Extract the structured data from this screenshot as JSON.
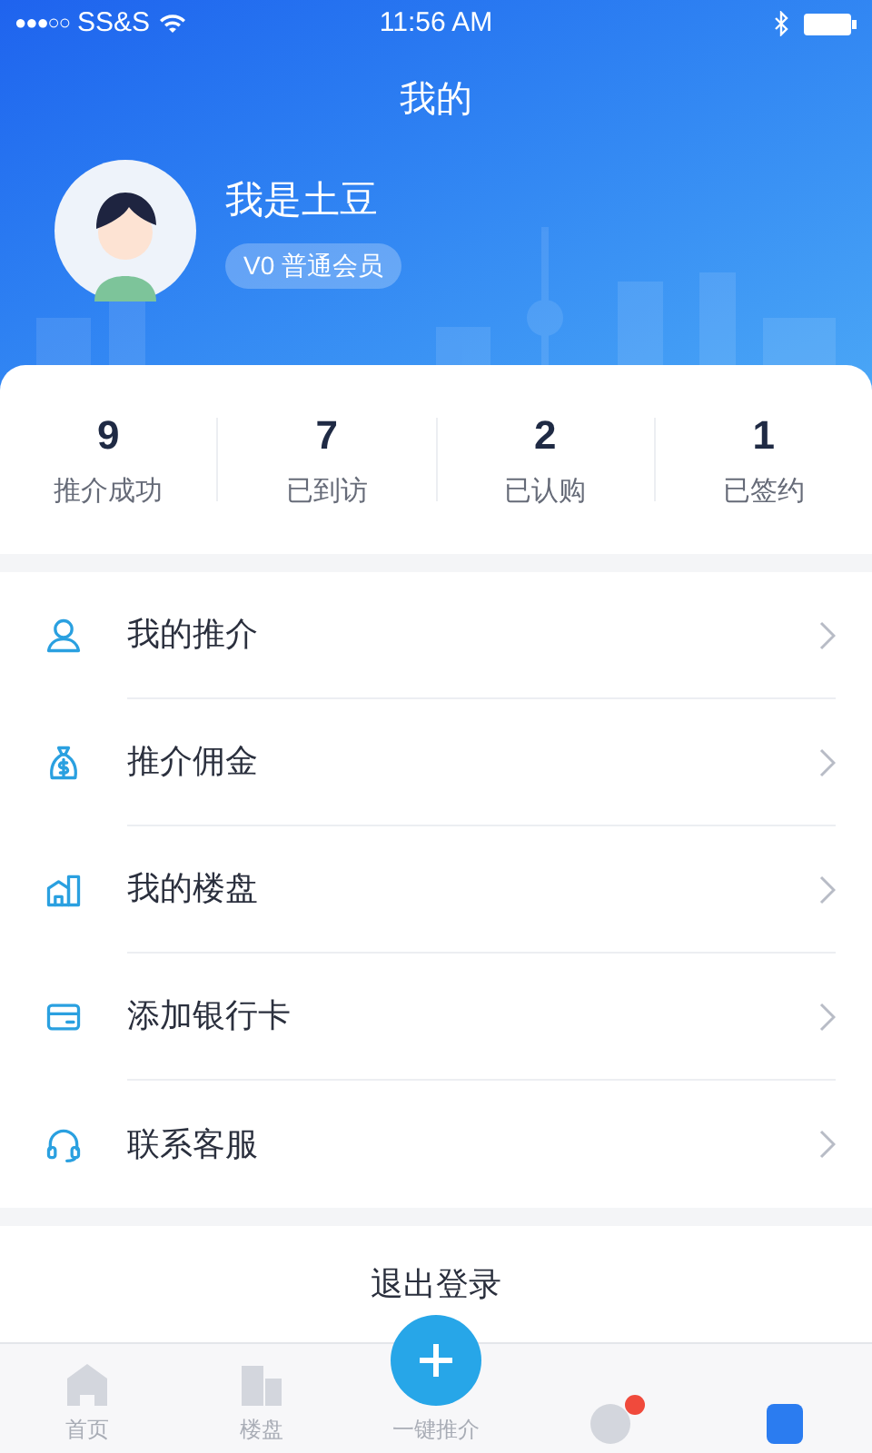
{
  "status_bar": {
    "signal": "●●●○○",
    "carrier": "SS&S",
    "time": "11:56 AM"
  },
  "title": "我的",
  "profile": {
    "name": "我是土豆",
    "badge": "V0 普通会员"
  },
  "stats": [
    {
      "value": "9",
      "label": "推介成功"
    },
    {
      "value": "7",
      "label": "已到访"
    },
    {
      "value": "2",
      "label": "已认购"
    },
    {
      "value": "1",
      "label": "已签约"
    }
  ],
  "menu": [
    {
      "kind": "person",
      "label": "我的推介"
    },
    {
      "kind": "money",
      "label": "推介佣金"
    },
    {
      "kind": "building",
      "label": "我的楼盘"
    },
    {
      "kind": "card",
      "label": "添加银行卡"
    },
    {
      "kind": "headset",
      "label": "联系客服"
    }
  ],
  "logout": "退出登录",
  "tabs": [
    {
      "kind": "home",
      "label": "首页",
      "selected": false
    },
    {
      "kind": "buildings",
      "label": "楼盘",
      "selected": false
    },
    {
      "kind": "add",
      "label": "一键推介",
      "selected": false
    },
    {
      "kind": "message",
      "selected": false,
      "badge": true
    },
    {
      "kind": "me",
      "selected": true
    }
  ]
}
